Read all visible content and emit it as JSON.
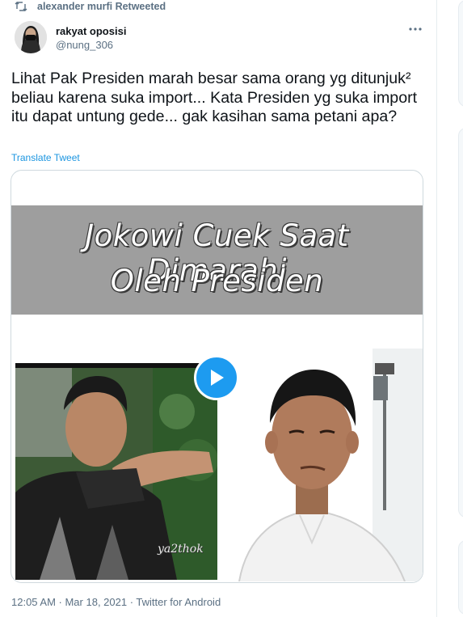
{
  "retweet": {
    "text": "alexander murfi Retweeted",
    "icon": "retweet-icon"
  },
  "author": {
    "name": "rakyat oposisi",
    "handle": "@nung_306"
  },
  "tweet": {
    "text": "Lihat Pak Presiden marah besar sama orang yg ditunjuk² beliau karena suka import... Kata Presiden yg suka import itu dapat untung gede... gak kasihan sama petani apa?",
    "translate_label": "Translate Tweet"
  },
  "media": {
    "title_line1": "Jokowi Cuek Saat Dimarahi",
    "title_line2": "Oleh Presiden",
    "watermark": "ya2thok",
    "play_icon": "play-icon"
  },
  "meta": {
    "timestamp": "12:05 AM · Mar 18, 2021 · Twitter for Android"
  },
  "colors": {
    "accent": "#1d9bf0",
    "link": "#1b95e0",
    "secondary_text": "#5b7083",
    "banner": "#9e9e9e"
  }
}
